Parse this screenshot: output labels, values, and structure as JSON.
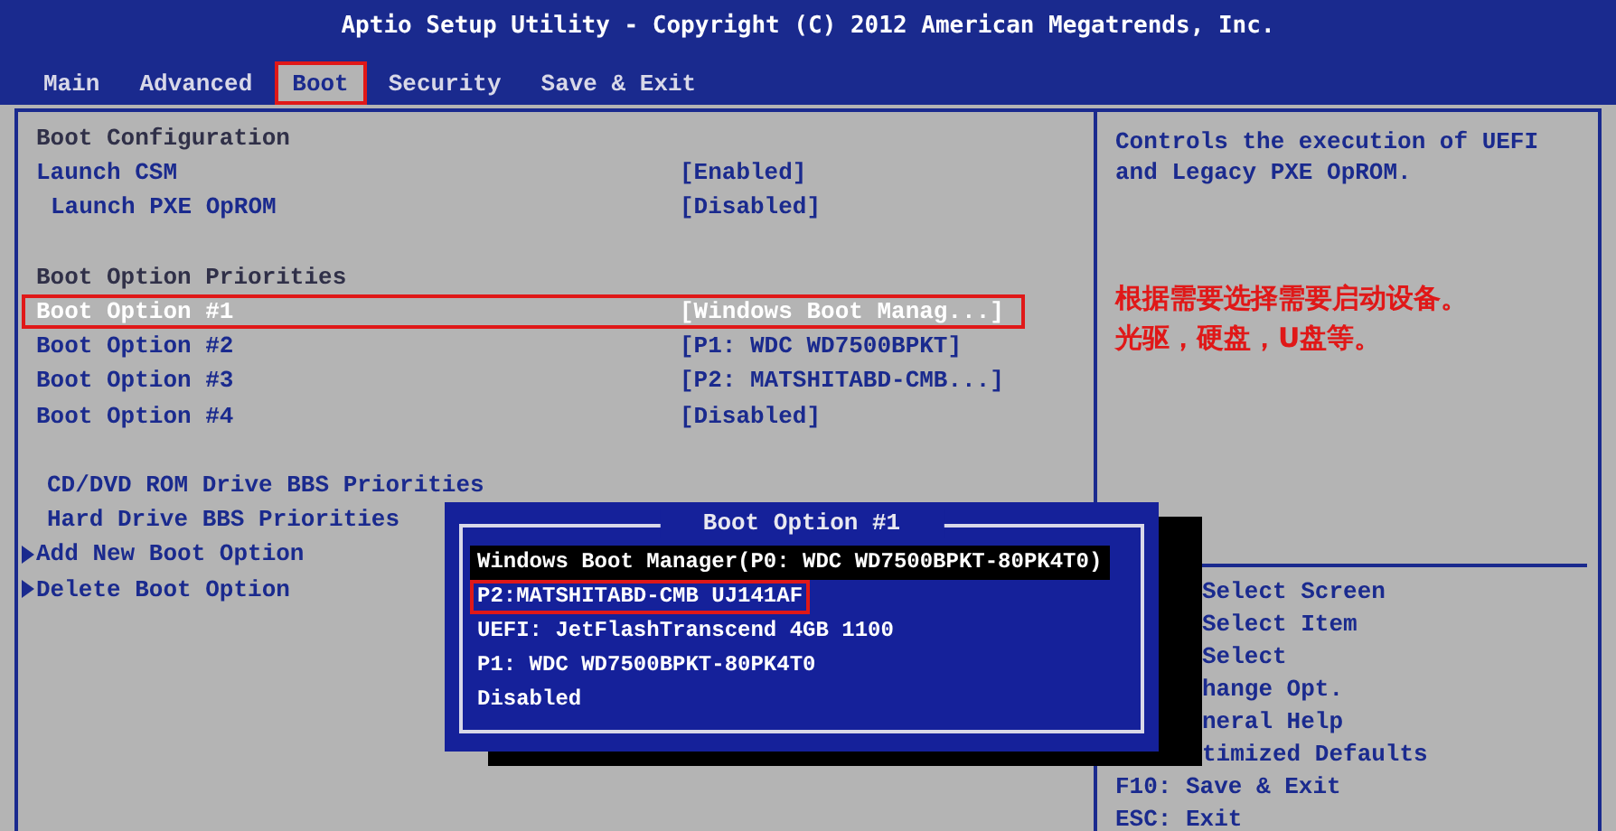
{
  "window": {
    "title": "Aptio Setup Utility - Copyright (C) 2012 American Megatrends, Inc."
  },
  "tabs": [
    {
      "label": "Main",
      "selected": false,
      "highlighted": false
    },
    {
      "label": "Advanced",
      "selected": false,
      "highlighted": false
    },
    {
      "label": "Boot",
      "selected": true,
      "highlighted": true
    },
    {
      "label": "Security",
      "selected": false,
      "highlighted": false
    },
    {
      "label": "Save & Exit",
      "selected": false,
      "highlighted": false
    }
  ],
  "settings": [
    {
      "kind": "heading",
      "label": "Boot Configuration"
    },
    {
      "kind": "option",
      "label": "Launch CSM",
      "value": "[Enabled]",
      "selected": false,
      "highlighted": false
    },
    {
      "kind": "suboption",
      "label": "Launch PXE OpROM",
      "value": "[Disabled]",
      "selected": false,
      "highlighted": false
    },
    {
      "kind": "spacer"
    },
    {
      "kind": "heading",
      "label": "Boot Option Priorities"
    },
    {
      "kind": "option",
      "label": "Boot Option #1",
      "value": "[Windows Boot Manag...]",
      "selected": true,
      "highlighted": true
    },
    {
      "kind": "option",
      "label": "Boot Option #2",
      "value": "[P1: WDC WD7500BPKT]",
      "selected": false,
      "highlighted": false
    },
    {
      "kind": "option",
      "label": "Boot Option #3",
      "value": "[P2: MATSHITABD-CMB...]",
      "selected": false,
      "highlighted": false
    },
    {
      "kind": "option",
      "label": "Boot Option #4",
      "value": "[Disabled]",
      "selected": false,
      "highlighted": false
    },
    {
      "kind": "spacer"
    },
    {
      "kind": "submenu",
      "label": "CD/DVD ROM Drive BBS Priorities"
    },
    {
      "kind": "submenu",
      "label": "Hard Drive BBS Priorities"
    },
    {
      "kind": "link",
      "label": "Add New Boot Option"
    },
    {
      "kind": "link",
      "label": "Delete Boot Option"
    }
  ],
  "help": {
    "text": "Controls the execution of UEFI and Legacy PXE OpROM.",
    "note": [
      "根据需要选择需要启动设备。",
      "光驱，硬盘，U盘等。"
    ]
  },
  "keys": [
    {
      "kind": "covered",
      "text": "Select Screen"
    },
    {
      "kind": "covered",
      "text": "Select Item"
    },
    {
      "kind": "covered",
      "text": "Select"
    },
    {
      "kind": "covered",
      "text": "hange Opt."
    },
    {
      "kind": "covered",
      "text": "neral Help"
    },
    {
      "kind": "covered",
      "text": "timized Defaults"
    },
    {
      "kind": "full",
      "text": "F10: Save & Exit"
    },
    {
      "kind": "full",
      "text": "ESC: Exit"
    }
  ],
  "popup": {
    "title": "Boot Option #1",
    "items": [
      {
        "label": "Windows Boot Manager(P0: WDC WD7500BPKT-80PK4T0)",
        "selected": true,
        "highlighted": false
      },
      {
        "label": "P2:MATSHITABD-CMB UJ141AF",
        "selected": false,
        "highlighted": true
      },
      {
        "label": "UEFI: JetFlashTranscend 4GB 1100",
        "selected": false,
        "highlighted": false
      },
      {
        "label": "P1: WDC WD7500BPKT-80PK4T0",
        "selected": false,
        "highlighted": false
      },
      {
        "label": "Disabled",
        "selected": false,
        "highlighted": false
      }
    ]
  }
}
